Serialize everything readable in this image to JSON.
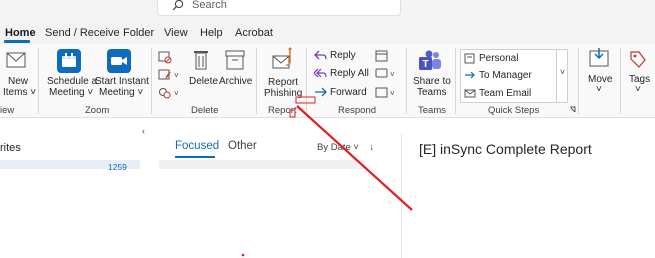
{
  "search": {
    "placeholder": "Search"
  },
  "menu": {
    "tabs": [
      "Home",
      "Send / Receive",
      "Folder",
      "View",
      "Help",
      "Acrobat"
    ],
    "active": "Home"
  },
  "ribbon": {
    "new_items": {
      "line1": "New",
      "line2": "Items",
      "line2_prefix": "iew"
    },
    "zoom": {
      "schedule_line1": "Schedule a",
      "schedule_line2": "Meeting",
      "instant_line1": "Start Instant",
      "instant_line2": "Meeting",
      "group": "Zoom"
    },
    "delete": {
      "delete_label": "Delete",
      "archive_label": "Archive",
      "group": "Delete"
    },
    "report": {
      "line1": "Report",
      "line2": "Phishing",
      "group": "Report"
    },
    "respond": {
      "reply": "Reply",
      "reply_all": "Reply All",
      "forward": "Forward",
      "group": "Respond"
    },
    "teams": {
      "line1": "Share to",
      "line2": "Teams",
      "group": "Teams"
    },
    "quicksteps": {
      "personal": "Personal",
      "to_manager": "To Manager",
      "team_email": "Team Email",
      "group": "Quick Steps"
    },
    "move": {
      "label": "Move"
    },
    "tags": {
      "label": "Tags"
    }
  },
  "folders": {
    "favorites_label": "rites",
    "count": "1259"
  },
  "list": {
    "focused": "Focused",
    "other": "Other",
    "sort": "By Date"
  },
  "reading": {
    "subject": "[E] inSync Complete Report"
  },
  "colors": {
    "accent": "#0f6cbd",
    "annotation": "#e02020"
  }
}
